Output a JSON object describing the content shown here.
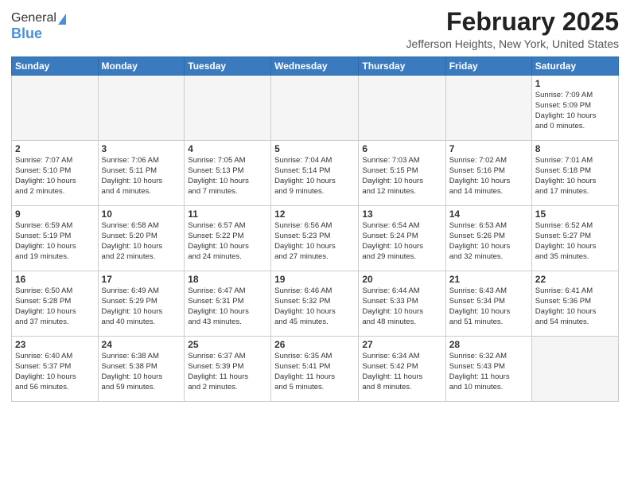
{
  "header": {
    "logo_line1": "General",
    "logo_line2": "Blue",
    "month_title": "February 2025",
    "location": "Jefferson Heights, New York, United States"
  },
  "weekdays": [
    "Sunday",
    "Monday",
    "Tuesday",
    "Wednesday",
    "Thursday",
    "Friday",
    "Saturday"
  ],
  "weeks": [
    [
      {
        "day": "",
        "info": ""
      },
      {
        "day": "",
        "info": ""
      },
      {
        "day": "",
        "info": ""
      },
      {
        "day": "",
        "info": ""
      },
      {
        "day": "",
        "info": ""
      },
      {
        "day": "",
        "info": ""
      },
      {
        "day": "1",
        "info": "Sunrise: 7:09 AM\nSunset: 5:09 PM\nDaylight: 10 hours\nand 0 minutes."
      }
    ],
    [
      {
        "day": "2",
        "info": "Sunrise: 7:07 AM\nSunset: 5:10 PM\nDaylight: 10 hours\nand 2 minutes."
      },
      {
        "day": "3",
        "info": "Sunrise: 7:06 AM\nSunset: 5:11 PM\nDaylight: 10 hours\nand 4 minutes."
      },
      {
        "day": "4",
        "info": "Sunrise: 7:05 AM\nSunset: 5:13 PM\nDaylight: 10 hours\nand 7 minutes."
      },
      {
        "day": "5",
        "info": "Sunrise: 7:04 AM\nSunset: 5:14 PM\nDaylight: 10 hours\nand 9 minutes."
      },
      {
        "day": "6",
        "info": "Sunrise: 7:03 AM\nSunset: 5:15 PM\nDaylight: 10 hours\nand 12 minutes."
      },
      {
        "day": "7",
        "info": "Sunrise: 7:02 AM\nSunset: 5:16 PM\nDaylight: 10 hours\nand 14 minutes."
      },
      {
        "day": "8",
        "info": "Sunrise: 7:01 AM\nSunset: 5:18 PM\nDaylight: 10 hours\nand 17 minutes."
      }
    ],
    [
      {
        "day": "9",
        "info": "Sunrise: 6:59 AM\nSunset: 5:19 PM\nDaylight: 10 hours\nand 19 minutes."
      },
      {
        "day": "10",
        "info": "Sunrise: 6:58 AM\nSunset: 5:20 PM\nDaylight: 10 hours\nand 22 minutes."
      },
      {
        "day": "11",
        "info": "Sunrise: 6:57 AM\nSunset: 5:22 PM\nDaylight: 10 hours\nand 24 minutes."
      },
      {
        "day": "12",
        "info": "Sunrise: 6:56 AM\nSunset: 5:23 PM\nDaylight: 10 hours\nand 27 minutes."
      },
      {
        "day": "13",
        "info": "Sunrise: 6:54 AM\nSunset: 5:24 PM\nDaylight: 10 hours\nand 29 minutes."
      },
      {
        "day": "14",
        "info": "Sunrise: 6:53 AM\nSunset: 5:26 PM\nDaylight: 10 hours\nand 32 minutes."
      },
      {
        "day": "15",
        "info": "Sunrise: 6:52 AM\nSunset: 5:27 PM\nDaylight: 10 hours\nand 35 minutes."
      }
    ],
    [
      {
        "day": "16",
        "info": "Sunrise: 6:50 AM\nSunset: 5:28 PM\nDaylight: 10 hours\nand 37 minutes."
      },
      {
        "day": "17",
        "info": "Sunrise: 6:49 AM\nSunset: 5:29 PM\nDaylight: 10 hours\nand 40 minutes."
      },
      {
        "day": "18",
        "info": "Sunrise: 6:47 AM\nSunset: 5:31 PM\nDaylight: 10 hours\nand 43 minutes."
      },
      {
        "day": "19",
        "info": "Sunrise: 6:46 AM\nSunset: 5:32 PM\nDaylight: 10 hours\nand 45 minutes."
      },
      {
        "day": "20",
        "info": "Sunrise: 6:44 AM\nSunset: 5:33 PM\nDaylight: 10 hours\nand 48 minutes."
      },
      {
        "day": "21",
        "info": "Sunrise: 6:43 AM\nSunset: 5:34 PM\nDaylight: 10 hours\nand 51 minutes."
      },
      {
        "day": "22",
        "info": "Sunrise: 6:41 AM\nSunset: 5:36 PM\nDaylight: 10 hours\nand 54 minutes."
      }
    ],
    [
      {
        "day": "23",
        "info": "Sunrise: 6:40 AM\nSunset: 5:37 PM\nDaylight: 10 hours\nand 56 minutes."
      },
      {
        "day": "24",
        "info": "Sunrise: 6:38 AM\nSunset: 5:38 PM\nDaylight: 10 hours\nand 59 minutes."
      },
      {
        "day": "25",
        "info": "Sunrise: 6:37 AM\nSunset: 5:39 PM\nDaylight: 11 hours\nand 2 minutes."
      },
      {
        "day": "26",
        "info": "Sunrise: 6:35 AM\nSunset: 5:41 PM\nDaylight: 11 hours\nand 5 minutes."
      },
      {
        "day": "27",
        "info": "Sunrise: 6:34 AM\nSunset: 5:42 PM\nDaylight: 11 hours\nand 8 minutes."
      },
      {
        "day": "28",
        "info": "Sunrise: 6:32 AM\nSunset: 5:43 PM\nDaylight: 11 hours\nand 10 minutes."
      },
      {
        "day": "",
        "info": ""
      }
    ]
  ]
}
